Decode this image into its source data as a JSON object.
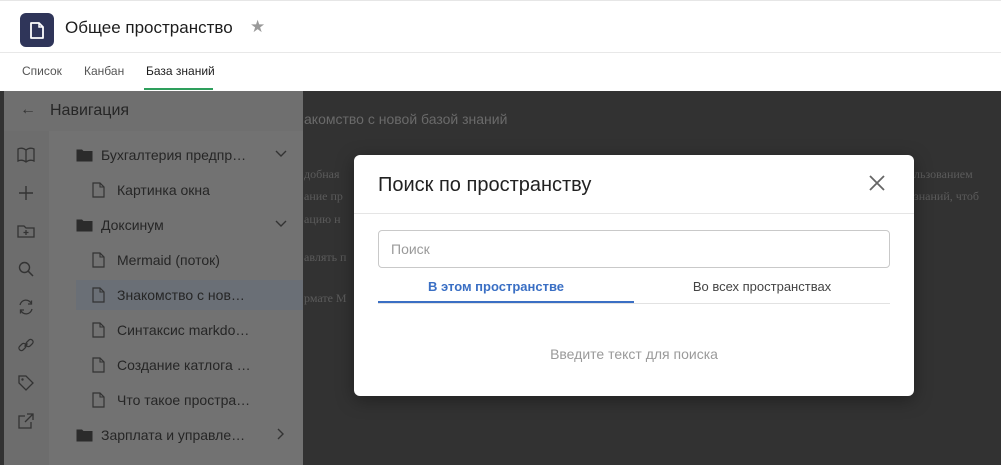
{
  "header": {
    "title": "Общее пространство",
    "star_icon": "star-icon",
    "app_icon": "document-icon"
  },
  "tabs": [
    {
      "label": "Список",
      "active": false
    },
    {
      "label": "Канбан",
      "active": false
    },
    {
      "label": "База знаний",
      "active": true
    }
  ],
  "colors": {
    "accent_blue": "#3a6fc4",
    "tab_underline_green": "#2e9f5c",
    "app_icon_bg": "#2f3559"
  },
  "sidebar": {
    "title": "Навигация",
    "back_icon": "arrow-left-icon",
    "rail_icons": [
      "book-icon",
      "plus-icon",
      "folder-plus-icon",
      "search-icon",
      "sync-icon",
      "link-icon",
      "tag-icon",
      "external-link-icon"
    ],
    "tree": [
      {
        "label": "Бухгалтерия предпр…",
        "type": "folder",
        "chevron": "down"
      },
      {
        "label": "Картинка окна",
        "type": "page"
      },
      {
        "label": "Доксинум",
        "type": "folder",
        "chevron": "down"
      },
      {
        "label": "Mermaid (поток)",
        "type": "page"
      },
      {
        "label": "Знакомство с нов…",
        "type": "page",
        "selected": true
      },
      {
        "label": "Синтаксис markdo…",
        "type": "page"
      },
      {
        "label": "Создание катлога …",
        "type": "page"
      },
      {
        "label": "Что такое простра…",
        "type": "page"
      },
      {
        "label": "Зарплата и управле…",
        "type": "folder",
        "chevron": "right"
      }
    ]
  },
  "document": {
    "heading": "акомство с новой базой знаний",
    "lines": [
      "добная",
      "ание пр",
      "ацию н",
      "авлять п",
      "рмате  М",
      "льзованием",
      "знаний, чтоб"
    ]
  },
  "modal": {
    "title": "Поиск по пространству",
    "close_icon": "close-icon",
    "search_placeholder": "Поиск",
    "search_value": "",
    "tabs": [
      {
        "label": "В этом пространстве",
        "active": true
      },
      {
        "label": "Во всех пространствах",
        "active": false
      }
    ],
    "empty_hint": "Введите текст для поиска"
  }
}
